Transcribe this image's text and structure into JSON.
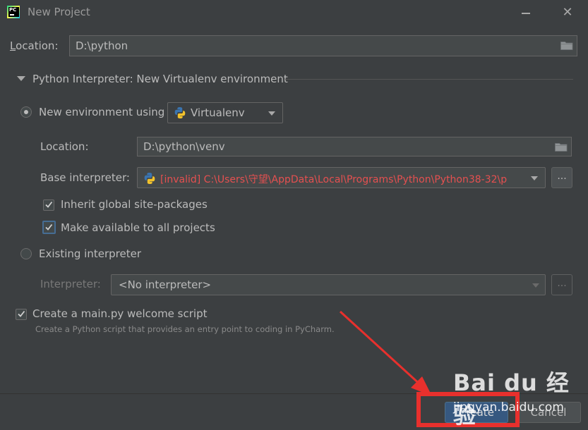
{
  "window": {
    "title": "New Project",
    "minimize_glyph": "",
    "close_glyph": "✕",
    "logo_text": "PC"
  },
  "location": {
    "label_prefix": "L",
    "label_rest": "ocation:",
    "value": "D:\\python"
  },
  "interpreter_section": {
    "header": "Python Interpreter: New Virtualenv environment",
    "new_env": {
      "label": "New environment using",
      "selected": true,
      "tool": "Virtualenv",
      "location_label": "Location:",
      "location_value": "D:\\python\\venv",
      "base_label": "Base interpreter:",
      "base_value": "[invalid] C:\\Users\\守望\\AppData\\Local\\Programs\\Python\\Python38-32\\p",
      "browse_label": "...",
      "inherit_label": "Inherit global site-packages",
      "inherit_checked": true,
      "make_available_label": "Make available to all projects",
      "make_available_checked": true
    },
    "existing": {
      "label": "Existing interpreter",
      "selected": false,
      "interpreter_label": "Interpreter:",
      "interpreter_value": "<No interpreter>",
      "browse_label": "..."
    }
  },
  "welcome_script": {
    "label": "Create a main.py welcome script",
    "checked": true,
    "description": "Create a Python script that provides an entry point to coding in PyCharm."
  },
  "buttons": {
    "create": "Create",
    "cancel": "Cancel"
  },
  "watermark": {
    "logo": "Bai du 经验",
    "url": "jingyan.baidu.com"
  },
  "colors": {
    "background": "#3c3f41",
    "invalid_text": "#e55050",
    "primary_button": "#365880",
    "annotation": "#e8302d"
  }
}
